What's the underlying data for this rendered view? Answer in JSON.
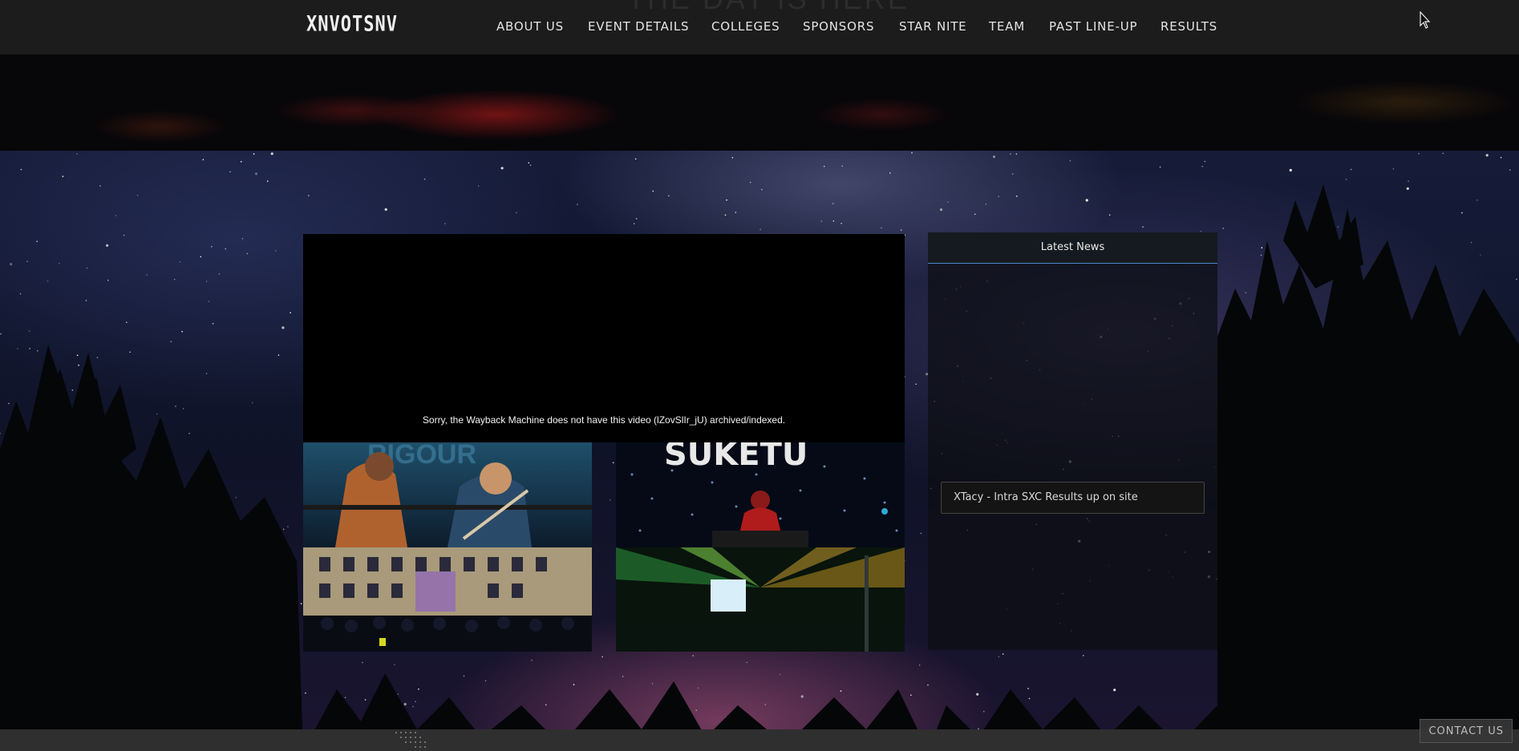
{
  "header": {
    "logo_text": "XNVOTSNV",
    "ghost_title": "THE DAY IS HERE"
  },
  "nav": {
    "items": [
      {
        "label": "ABOUT US"
      },
      {
        "label": "EVENT DETAILS"
      },
      {
        "label": "COLLEGES"
      },
      {
        "label": "SPONSORS"
      },
      {
        "label": "STAR NITE"
      },
      {
        "label": "TEAM"
      },
      {
        "label": "PAST LINE-UP"
      },
      {
        "label": "RESULTS"
      }
    ]
  },
  "video": {
    "message": "Sorry, the Wayback Machine does not have this video (lZovSlIr_jU) archived/indexed."
  },
  "gallery": {
    "thumbs": [
      {
        "icon": "concert-band-photo",
        "overlay_text": "RIGOUR"
      },
      {
        "icon": "dj-stage-photo",
        "overlay_text": "SUKETU"
      },
      {
        "icon": "college-crowd-photo"
      },
      {
        "icon": "laser-stage-photo"
      }
    ]
  },
  "news": {
    "title": "Latest News",
    "items": [
      {
        "text": "XTacy - Intra SXC Results up on site"
      }
    ]
  },
  "contact": {
    "label": "CONTACT US"
  },
  "colors": {
    "navbar_bg": "#1c1c1c",
    "news_header_border": "#4a88c8",
    "footer_bg": "#2f2f2f"
  }
}
